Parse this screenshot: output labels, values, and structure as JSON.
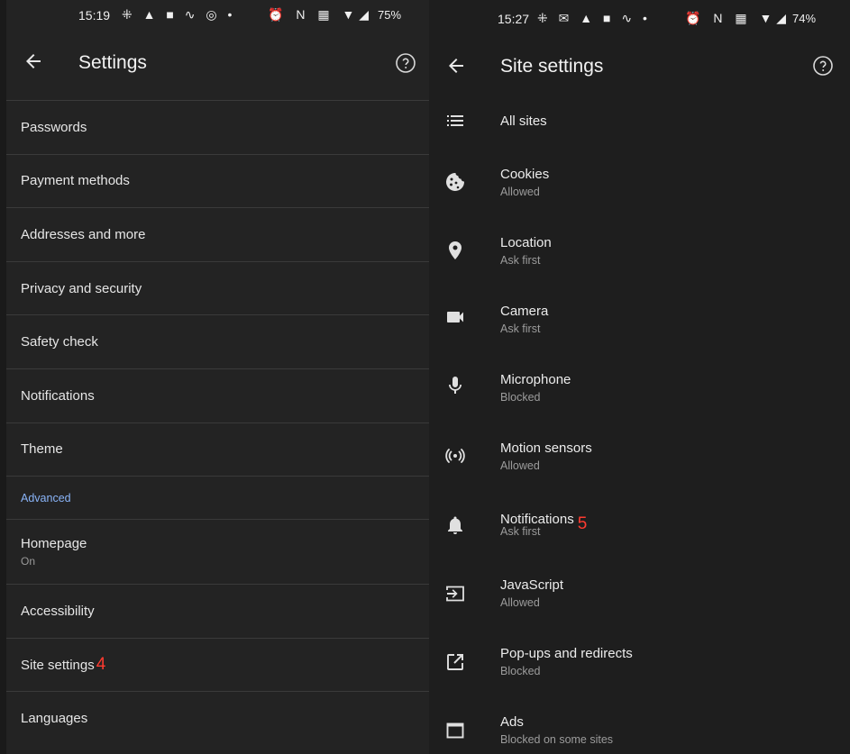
{
  "left": {
    "status": {
      "time": "15:19",
      "left_icons": "⁜ ▲ ■ ∿ ◎ •",
      "right_icons": "⏰ N ▦ ▼◢",
      "battery": "75%"
    },
    "title": "Settings",
    "items": [
      {
        "label": "Passwords"
      },
      {
        "label": "Payment methods"
      },
      {
        "label": "Addresses and more"
      },
      {
        "label": "Privacy and security"
      },
      {
        "label": "Safety check"
      },
      {
        "label": "Notifications"
      },
      {
        "label": "Theme"
      }
    ],
    "section_advanced": "Advanced",
    "homepage": {
      "label": "Homepage",
      "sub": "On"
    },
    "accessibility": "Accessibility",
    "site_settings": "Site settings",
    "site_settings_marker": "4",
    "languages": "Languages"
  },
  "right": {
    "status": {
      "time": "15:27",
      "left_icons": "⁜ ✉ ▲ ■ ∿ •",
      "right_icons": "⏰ N ▦ ▼◢",
      "battery": "74%"
    },
    "title": "Site settings",
    "rows": [
      {
        "icon": "list-icon",
        "label": "All sites",
        "sub": ""
      },
      {
        "icon": "cookie-icon",
        "label": "Cookies",
        "sub": "Allowed"
      },
      {
        "icon": "location-pin-icon",
        "label": "Location",
        "sub": "Ask first"
      },
      {
        "icon": "video-camera-icon",
        "label": "Camera",
        "sub": "Ask first"
      },
      {
        "icon": "microphone-icon",
        "label": "Microphone",
        "sub": "Blocked"
      },
      {
        "icon": "motion-sensor-icon",
        "label": "Motion sensors",
        "sub": "Allowed"
      },
      {
        "icon": "bell-icon",
        "label": "Notifications",
        "sub": "Ask first"
      },
      {
        "icon": "javascript-icon",
        "label": "JavaScript",
        "sub": "Allowed"
      },
      {
        "icon": "popup-open-icon",
        "label": "Pop-ups and redirects",
        "sub": "Blocked"
      },
      {
        "icon": "ads-window-icon",
        "label": "Ads",
        "sub": "Blocked on some sites"
      }
    ],
    "notifications_marker": "5"
  },
  "colors": {
    "accent_section": "#8ab4f8",
    "marker_red": "#ff3b30"
  }
}
